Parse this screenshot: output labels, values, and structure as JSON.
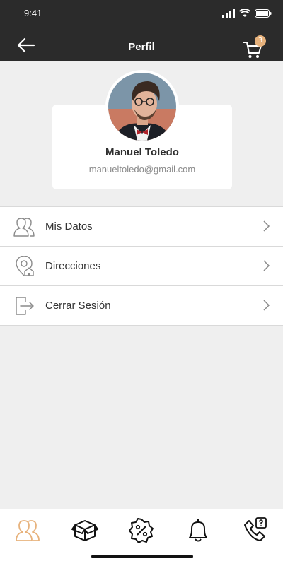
{
  "status_bar": {
    "time": "9:41"
  },
  "header": {
    "title": "Perfil",
    "cart_count": "3"
  },
  "profile": {
    "name": "Manuel Toledo",
    "email": "manueltoledo@gmail.com"
  },
  "menu": {
    "items": [
      {
        "label": "Mis Datos",
        "icon": "user-group-icon"
      },
      {
        "label": "Direcciones",
        "icon": "location-home-icon"
      },
      {
        "label": "Cerrar Sesión",
        "icon": "logout-icon"
      }
    ]
  },
  "tabbar": {
    "tabs": [
      {
        "icon": "users-icon",
        "active": true
      },
      {
        "icon": "box-icon",
        "active": false
      },
      {
        "icon": "discount-badge-icon",
        "active": false
      },
      {
        "icon": "bell-icon",
        "active": false
      },
      {
        "icon": "phone-help-icon",
        "active": false
      }
    ]
  },
  "colors": {
    "header_bg": "#2b2b2b",
    "accent": "#e7b27c",
    "background": "#efefef"
  }
}
